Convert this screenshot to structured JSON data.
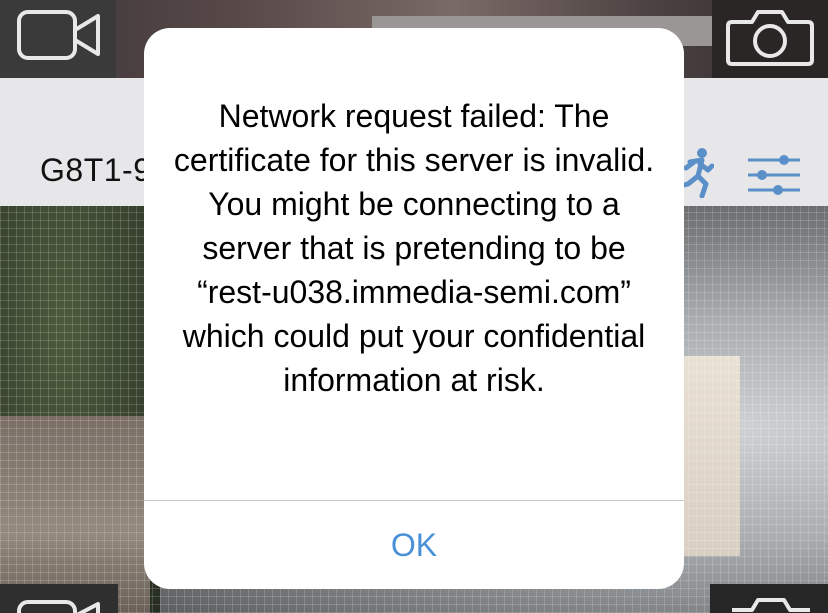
{
  "top_bar": {
    "video_icon": "video-camera-outline",
    "camera_icon": "snapshot-camera"
  },
  "camera": {
    "name": "G8T1-9",
    "motion_icon": "running-person",
    "settings_icon": "sliders"
  },
  "alert": {
    "message": "Network request failed: The certificate for this server is invalid. You might be connecting to a server that is pretending to be “rest-u038.immedia-semi.com” which could put your confidential information at risk.",
    "ok_label": "OK"
  },
  "colors": {
    "accent": "#4a90d9",
    "info_bar_bg": "#e7e7e9",
    "alert_bg": "#ffffff"
  }
}
